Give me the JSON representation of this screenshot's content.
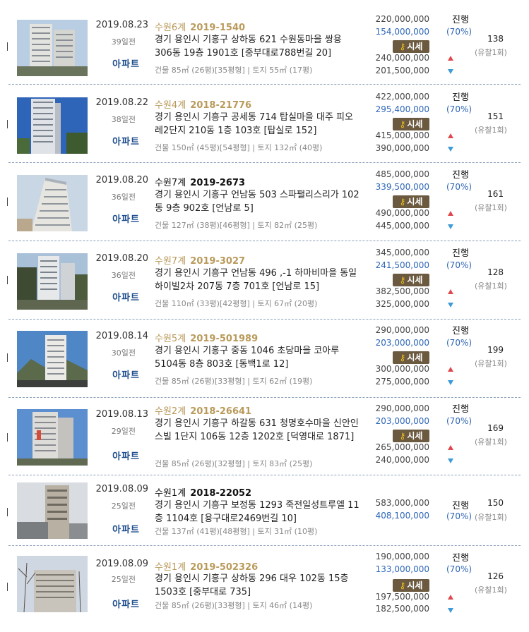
{
  "listings": [
    {
      "date": "2019.08.23",
      "ago": "39일전",
      "type": "아파트",
      "court_name": "수원6계",
      "case_no": "2019-1540",
      "court_dark": false,
      "address": "경기 용인시 기흥구 상하동 621 수원동마을 쌍용 306동 19층 1901호 [중부대로788번길 20]",
      "area": "건물 85㎡ (26평)[35평형] | 토지 55㎡ (17평)",
      "appraisal": "220,000,000",
      "min_price": "154,000,000",
      "market_label": "시세",
      "market_high": "240,000,000",
      "market_low": "201,500,000",
      "status": "진행",
      "rate": "(70%)",
      "views": "138",
      "bid_count": "(유찰1회)"
    },
    {
      "date": "2019.08.22",
      "ago": "38일전",
      "type": "아파트",
      "court_name": "수원4계",
      "case_no": "2018-21776",
      "court_dark": false,
      "address": "경기 용인시 기흥구 공세동 714 탑실마을 대주 피오레2단지 210동 1층 103호 [탑실로 152]",
      "area": "건물 150㎡ (45평)[54평형] | 토지 132㎡ (40평)",
      "appraisal": "422,000,000",
      "min_price": "295,400,000",
      "market_label": "시세",
      "market_high": "415,000,000",
      "market_low": "390,000,000",
      "status": "진행",
      "rate": "(70%)",
      "views": "151",
      "bid_count": "(유찰1회)"
    },
    {
      "date": "2019.08.20",
      "ago": "36일전",
      "type": "아파트",
      "court_name": "수원7계",
      "case_no": "2019-2673",
      "court_dark": true,
      "address": "경기 용인시 기흥구 언남동 503 스파팰리스리가 102동 9층 902호 [언남로 5]",
      "area": "건물 127㎡ (38평)[46평형] | 토지 82㎡ (25평)",
      "appraisal": "485,000,000",
      "min_price": "339,500,000",
      "market_label": "시세",
      "market_high": "490,000,000",
      "market_low": "445,000,000",
      "status": "진행",
      "rate": "(70%)",
      "views": "161",
      "bid_count": "(유찰1회)"
    },
    {
      "date": "2019.08.20",
      "ago": "36일전",
      "type": "아파트",
      "court_name": "수원7계",
      "case_no": "2019-3027",
      "court_dark": false,
      "address": "경기 용인시 기흥구 언남동 496 ,-1 하마비마을 동일하이빌2차 207동 7층 701호 [언남로 15]",
      "area": "건물 110㎡ (33평)[42평형] | 토지 67㎡ (20평)",
      "appraisal": "345,000,000",
      "min_price": "241,500,000",
      "market_label": "시세",
      "market_high": "382,500,000",
      "market_low": "325,000,000",
      "status": "진행",
      "rate": "(70%)",
      "views": "128",
      "bid_count": "(유찰1회)"
    },
    {
      "date": "2019.08.14",
      "ago": "30일전",
      "type": "아파트",
      "court_name": "수원5계",
      "case_no": "2019-501989",
      "court_dark": false,
      "address": "경기 용인시 기흥구 중동 1046 초당마을 코아루 5104동 8층 803호 [동백1로 12]",
      "area": "건물 85㎡ (26평)[33평형] | 토지 62㎡ (19평)",
      "appraisal": "290,000,000",
      "min_price": "203,000,000",
      "market_label": "시세",
      "market_high": "300,000,000",
      "market_low": "275,000,000",
      "status": "진행",
      "rate": "(70%)",
      "views": "199",
      "bid_count": "(유찰1회)"
    },
    {
      "date": "2019.08.13",
      "ago": "29일전",
      "type": "아파트",
      "court_name": "수원2계",
      "case_no": "2018-26641",
      "court_dark": false,
      "address": "경기 용인시 기흥구 하갈동 631 청명호수마을 신안인스빌 1단지 106동 12층 1202호 [덕영대로 1871]",
      "area": "건물 85㎡ (26평)[32평형] | 토지 83㎡ (25평)",
      "appraisal": "290,000,000",
      "min_price": "203,000,000",
      "market_label": "시세",
      "market_high": "265,000,000",
      "market_low": "240,000,000",
      "status": "진행",
      "rate": "(70%)",
      "views": "169",
      "bid_count": "(유찰1회)"
    },
    {
      "date": "2019.08.09",
      "ago": "25일전",
      "type": "아파트",
      "court_name": "수원1계",
      "case_no": "2018-22052",
      "court_dark": true,
      "address": "경기 용인시 기흥구 보정동 1293 죽전일성트루엘 11층 1104호 [용구대로2469번길 10]",
      "area": "건물 137㎡ (41평)[48평형] | 토지 31㎡ (10평)",
      "appraisal": "583,000,000",
      "min_price": "408,100,000",
      "market_label": "",
      "market_high": "",
      "market_low": "",
      "status": "진행",
      "rate": "(70%)",
      "views": "150",
      "bid_count": "(유찰1회)"
    },
    {
      "date": "2019.08.09",
      "ago": "25일전",
      "type": "아파트",
      "court_name": "수원1계",
      "case_no": "2019-502326",
      "court_dark": false,
      "address": "경기 용인시 기흥구 상하동 296 대우 102동 15층 1503호 [중부대로 735]",
      "area": "건물 85㎡ (26평)[33평형] | 토지 46㎡ (14평)",
      "appraisal": "190,000,000",
      "min_price": "133,000,000",
      "market_label": "시세",
      "market_high": "197,500,000",
      "market_low": "182,500,000",
      "status": "진행",
      "rate": "(70%)",
      "views": "126",
      "bid_count": "(유찰1회)"
    }
  ],
  "colors": {
    "type": "#1d4d8c",
    "court": "#b99a5b",
    "min_price": "#2e66b7",
    "sise_bg": "#6b5a40",
    "up": "#e0484f",
    "down": "#3f9bd6"
  }
}
